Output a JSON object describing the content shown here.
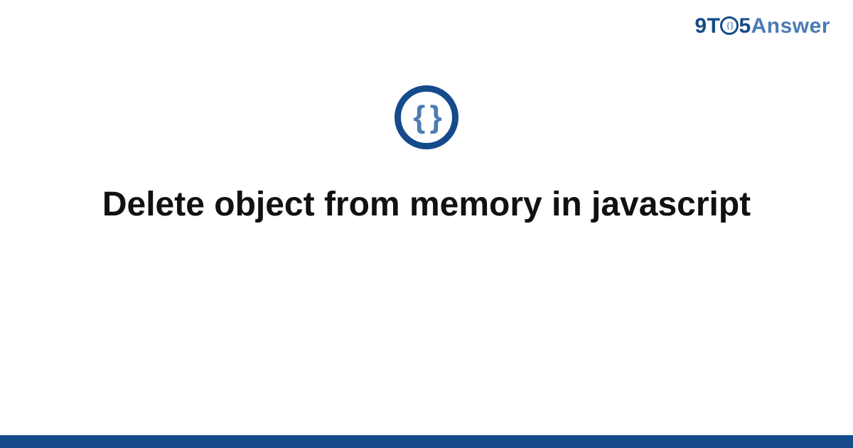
{
  "logo": {
    "nine": "9",
    "t": "T",
    "o_inner": "{ }",
    "five": "5",
    "answer": "Answer"
  },
  "badge": {
    "glyph": "{ }"
  },
  "title": "Delete object from memory in javascript",
  "colors": {
    "brand_dark": "#154b8a",
    "brand_light": "#4a7bb5"
  }
}
